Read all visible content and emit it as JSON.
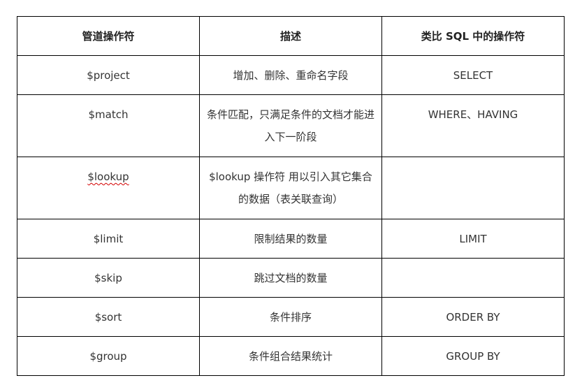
{
  "table": {
    "headers": [
      "管道操作符",
      "描述",
      "类比 SQL 中的操作符"
    ],
    "rows": [
      {
        "operator": "$project",
        "description": "增加、删除、重命名字段",
        "sql": "SELECT"
      },
      {
        "operator": "$match",
        "description": "条件匹配，只满足条件的文档才能进入下一阶段",
        "sql": "WHERE、HAVING"
      },
      {
        "operator": "$lookup",
        "description": "$lookup 操作符 用以引入其它集合的数据（表关联查询）",
        "sql": ""
      },
      {
        "operator": "$limit",
        "description": "限制结果的数量",
        "sql": "LIMIT"
      },
      {
        "operator": "$skip",
        "description": "跳过文档的数量",
        "sql": ""
      },
      {
        "operator": "$sort",
        "description": "条件排序",
        "sql": "ORDER BY"
      },
      {
        "operator": "$group",
        "description": "条件组合结果统计",
        "sql": "GROUP BY"
      }
    ]
  },
  "colors": {
    "border": "#000000",
    "text": "#333333",
    "spellcheck_underline": "#d40000"
  }
}
